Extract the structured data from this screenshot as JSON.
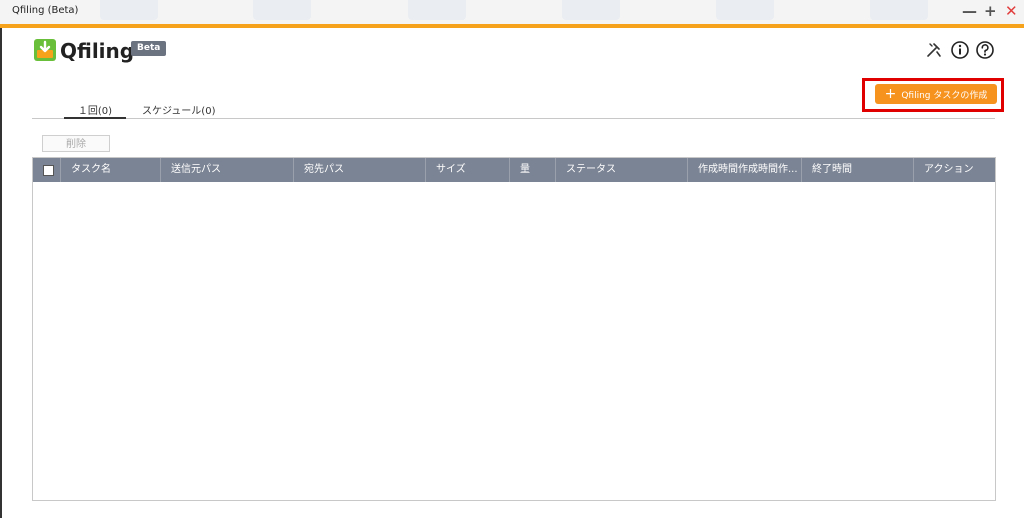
{
  "window": {
    "title": "Qfiling (Beta)",
    "minimize": "—",
    "maximize": "+",
    "close": "✕"
  },
  "header": {
    "app_name": "Qfiling",
    "badge": "Beta"
  },
  "actions": {
    "create_task": "Qfiling タスクの作成"
  },
  "tabs": [
    {
      "label": "１回(0)"
    },
    {
      "label": "スケジュール(0)"
    }
  ],
  "toolbar": {
    "delete_label": "削除"
  },
  "table": {
    "columns": [
      "タスク名",
      "送信元パス",
      "宛先パス",
      "サイズ",
      "量",
      "ステータス",
      "作成時間作成時間作...",
      "終了時間",
      "アクション"
    ]
  },
  "colors": {
    "accent": "#f6921e",
    "highlight": "#e00000",
    "table_header": "#7b8494"
  }
}
